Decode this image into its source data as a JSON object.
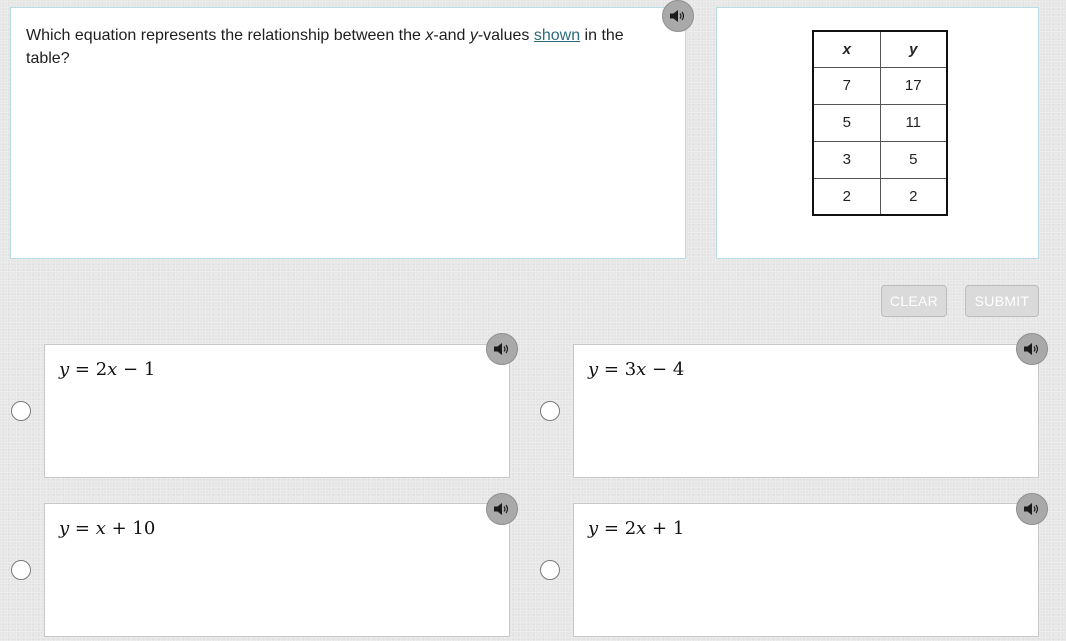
{
  "question": {
    "before_x": "Which equation represents the relationship between the ",
    "x_var": "x",
    "mid": "-and ",
    "y_var": "y",
    "after_y": "-values ",
    "link": "shown",
    "end": " in the table?"
  },
  "table": {
    "headers": [
      "x",
      "y"
    ],
    "rows": [
      [
        "7",
        "17"
      ],
      [
        "5",
        "11"
      ],
      [
        "3",
        "5"
      ],
      [
        "2",
        "2"
      ]
    ]
  },
  "buttons": {
    "clear": "CLEAR",
    "submit": "SUBMIT"
  },
  "options": [
    {
      "lhs": "y",
      "eq": " = ",
      "coef": "2",
      "var": "x",
      "op": " − ",
      "const": "1"
    },
    {
      "lhs": "y",
      "eq": " = ",
      "coef": "3",
      "var": "x",
      "op": " − ",
      "const": "4"
    },
    {
      "lhs": "y",
      "eq": " = ",
      "coef": "",
      "var": "x",
      "op": " + ",
      "const": "10"
    },
    {
      "lhs": "y",
      "eq": " = ",
      "coef": "2",
      "var": "x",
      "op": " + ",
      "const": "1"
    }
  ],
  "icons": {
    "audio": "speaker-icon"
  },
  "colors": {
    "panel_border": "#b9dde3",
    "link": "#2b6a7a",
    "audio_button": "#a9a9a9",
    "disabled_button": "#dadada"
  }
}
